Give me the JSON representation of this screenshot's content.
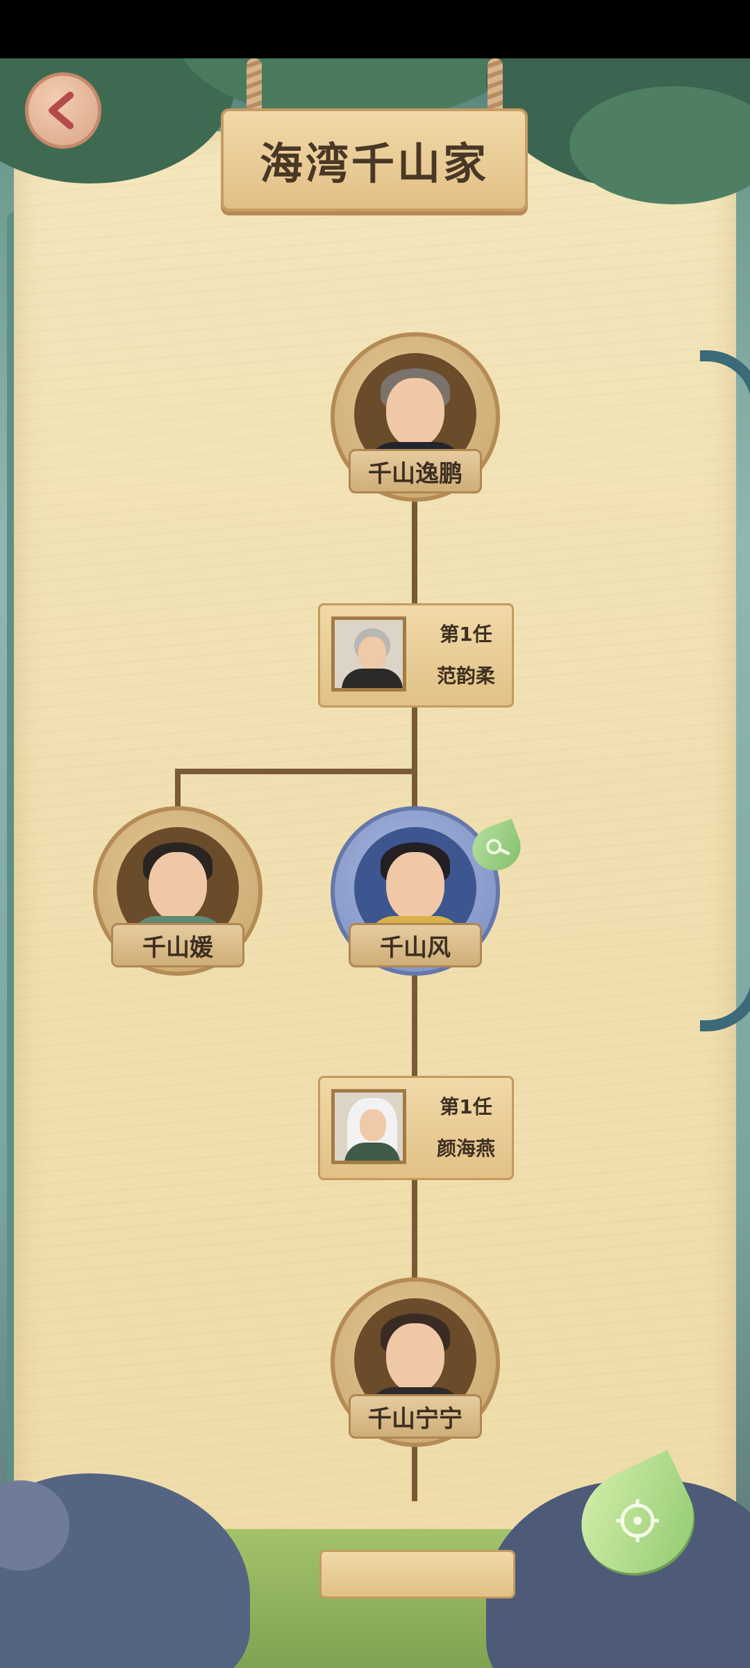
{
  "header": {
    "title": "海湾千山家"
  },
  "tree": {
    "gen1": {
      "name": "千山逸鹏"
    },
    "gen1_spouse": {
      "label": "第1任",
      "name": "范韵柔"
    },
    "gen2_a": {
      "name": "千山媛"
    },
    "gen2_b": {
      "name": "千山风"
    },
    "gen2_spouse": {
      "label": "第1任",
      "name": "颜海燕"
    },
    "gen3": {
      "name": "千山宁宁"
    }
  },
  "icons": {
    "back": "chevron-left-icon",
    "view": "magnifier-icon",
    "locate": "crosshair-icon"
  },
  "colors": {
    "line": "#7a5a36",
    "active_frame": "#7a8cc2",
    "title_text": "#4a3826"
  }
}
